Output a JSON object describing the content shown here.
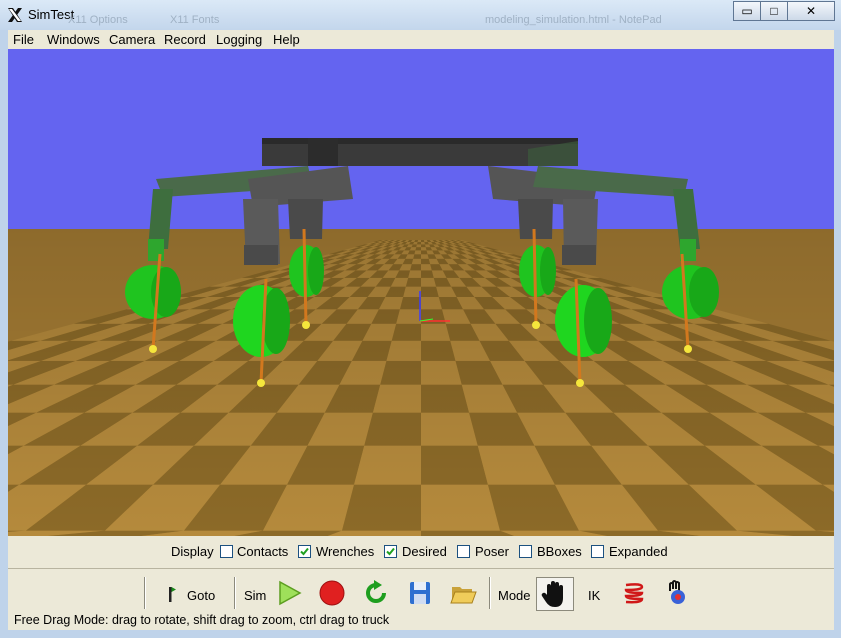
{
  "window": {
    "title": "SimTest",
    "ghost_titles": [
      "X11 Options",
      "X11 Fonts",
      "modeling_simulation.html - NotePad"
    ],
    "controls": {
      "minimize": "▭",
      "maximize": "□",
      "close": "✕"
    }
  },
  "menu": [
    "File",
    "Windows",
    "Camera",
    "Record",
    "Logging",
    "Help"
  ],
  "viewport": {
    "sky_color": "#6464f0",
    "floor_colors": [
      "#b58a3c",
      "#8c6a28"
    ],
    "robot_body_color": "#3c3c3c",
    "leg_color": "#2ea62e",
    "wheel_color": "#1fd61f",
    "wrench_color": "#d2781e"
  },
  "display": {
    "label": "Display",
    "options": [
      {
        "label": "Contacts",
        "checked": false
      },
      {
        "label": "Wrenches",
        "checked": true
      },
      {
        "label": "Desired",
        "checked": true
      },
      {
        "label": "Poser",
        "checked": false
      },
      {
        "label": "BBoxes",
        "checked": false
      },
      {
        "label": "Expanded",
        "checked": false
      }
    ]
  },
  "toolbar": {
    "goto_label": "Goto",
    "sim_label": "Sim",
    "mode_label": "Mode",
    "ik_label": "IK",
    "icons": [
      "flag-icon",
      "play-icon",
      "record-icon",
      "reset-icon",
      "save-icon",
      "open-folder-icon",
      "hand-icon",
      "spring-icon",
      "poser-icon"
    ]
  },
  "status": {
    "text": "Free Drag Mode: drag to rotate, shift drag to zoom, ctrl drag to truck"
  }
}
